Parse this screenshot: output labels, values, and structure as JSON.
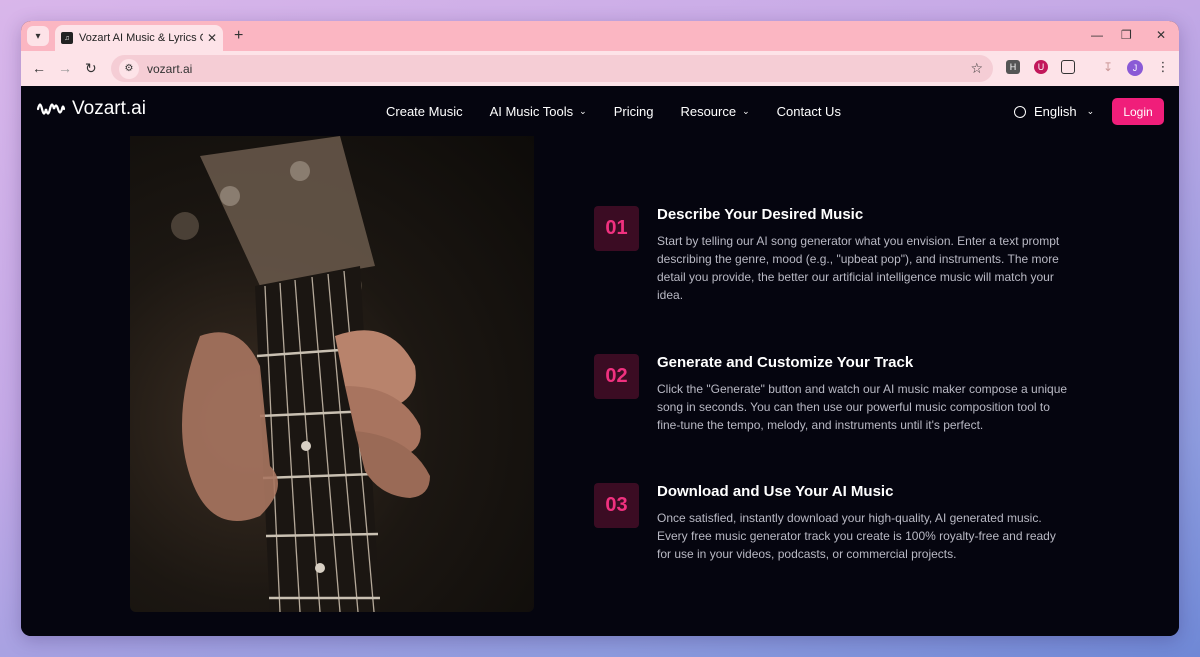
{
  "browser": {
    "tab_title": "Vozart AI Music & Lyrics Genera",
    "url": "vozart.ai",
    "profile_initial": "J"
  },
  "header": {
    "brand": "Vozart.ai",
    "nav": [
      {
        "label": "Create Music"
      },
      {
        "label": "AI Music Tools",
        "dropdown": true
      },
      {
        "label": "Pricing"
      },
      {
        "label": "Resource",
        "dropdown": true
      },
      {
        "label": "Contact Us"
      }
    ],
    "language": "English",
    "login_label": "Login"
  },
  "steps": [
    {
      "number": "01",
      "title": "Describe Your Desired Music",
      "text": "Start by telling our AI song generator what you envision. Enter a text prompt describing the genre, mood (e.g., \"upbeat pop\"), and instruments. The more detail you provide, the better our artificial intelligence music will match your idea."
    },
    {
      "number": "02",
      "title": "Generate and Customize Your Track",
      "text": "Click the \"Generate\" button and watch our AI music maker compose a unique song in seconds. You can then use our powerful music composition tool to fine-tune the tempo, melody, and instruments until it's perfect."
    },
    {
      "number": "03",
      "title": "Download and Use Your AI Music",
      "text": "Once satisfied, instantly download your high-quality, AI generated music. Every free music generator track you create is 100% royalty-free and ready for use in your videos, podcasts, or commercial projects."
    }
  ],
  "colors": {
    "accent": "#f01e7a",
    "badge_bg": "#3b0c23",
    "page_bg": "#05050f"
  }
}
